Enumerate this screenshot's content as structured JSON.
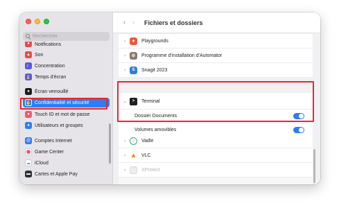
{
  "window": {
    "title": "Fichiers et dossiers"
  },
  "sidebar": {
    "search_placeholder": "Rechercher",
    "items": [
      {
        "label": "Notifications",
        "icon": "bell-icon",
        "color": "#e94b49"
      },
      {
        "label": "Son",
        "icon": "speaker-icon",
        "color": "#e94b49"
      },
      {
        "label": "Concentration",
        "icon": "moon-icon",
        "color": "#5b59d6"
      },
      {
        "label": "Temps d'écran",
        "icon": "hourglass-icon",
        "color": "#5b59d6"
      },
      {
        "label": "Écran verrouillé",
        "icon": "lock-screen-icon",
        "color": "#1d1d1f"
      },
      {
        "label": "Confidentialité et sécurité",
        "icon": "hand-icon",
        "color": "#2d7df6"
      },
      {
        "label": "Touch ID et mot de passe",
        "icon": "fingerprint-icon",
        "color": "#f25a70"
      },
      {
        "label": "Utilisateurs et groupes",
        "icon": "users-icon",
        "color": "#2d7df6"
      },
      {
        "label": "Comptes Internet",
        "icon": "at-icon",
        "color": "#2d7df6"
      },
      {
        "label": "Game Center",
        "icon": "game-center-icon",
        "color": "#e45e8e"
      },
      {
        "label": "iCloud",
        "icon": "cloud-icon",
        "color": "#3b8ef0"
      },
      {
        "label": "Cartes et Apple Pay",
        "icon": "wallet-icon",
        "color": "#2f2f31"
      }
    ]
  },
  "main": {
    "apps": [
      {
        "label": "Playgrounds",
        "icon": "playgrounds-icon",
        "color": "#f0573a"
      },
      {
        "label": "Programme d'installation d'Automator",
        "icon": "automator-icon",
        "color": "#8a7b6a"
      },
      {
        "label": "Snagit 2023",
        "icon": "snagit-icon",
        "color": "#2f7fd8"
      },
      {
        "label": "Vadle",
        "icon": "vadle-icon",
        "color": "#39a887"
      },
      {
        "label": "VLC",
        "icon": "vlc-cone-icon",
        "color": "#f08a1c"
      },
      {
        "label": "XProtect",
        "icon": "xprotect-icon",
        "color": "#d8d7da"
      }
    ],
    "terminal": {
      "label": "Terminal",
      "rows": [
        {
          "label": "Dossier Documents",
          "enabled": true
        },
        {
          "label": "Volumes amovibles",
          "enabled": true
        }
      ]
    }
  },
  "colors": {
    "accent": "#2d7df6",
    "highlight": "#e6262b"
  }
}
